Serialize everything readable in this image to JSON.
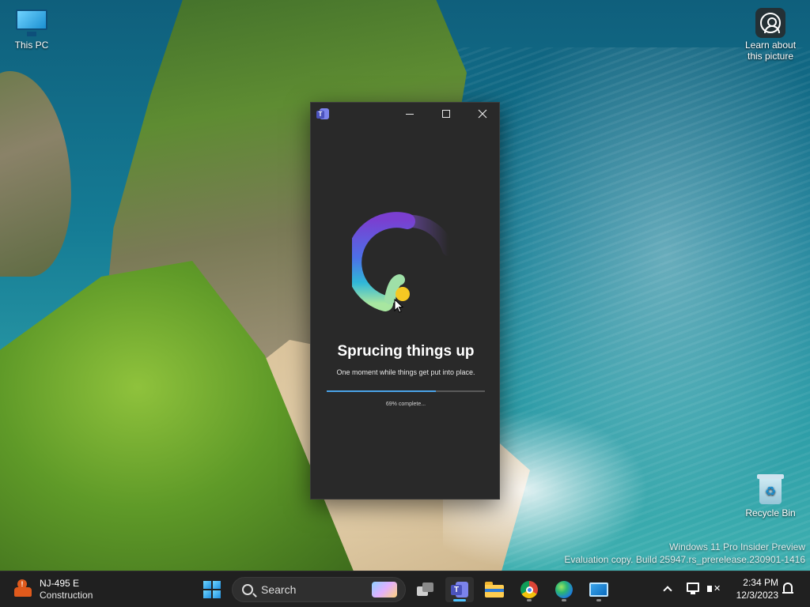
{
  "desktop": {
    "icons": [
      {
        "label": "This PC",
        "icon": "computer-icon"
      },
      {
        "label": "Learn about\nthis picture",
        "icon": "camera-icon"
      },
      {
        "label": "Recycle Bin",
        "icon": "recycle-bin-icon"
      }
    ],
    "watermark": {
      "line1": "Windows 11 Pro Insider Preview",
      "line2": "Evaluation copy. Build 25947.rs_prerelease.230901-1416"
    }
  },
  "teams_window": {
    "app_icon": "teams-icon",
    "title": "Sprucing things up",
    "subtitle": "One moment while things get put into place.",
    "progress": {
      "percent": 69,
      "text": "69% complete..."
    },
    "colors": {
      "background": "#292929",
      "progress_fill": "#4aa3e8",
      "progress_track": "#5a5a5a"
    }
  },
  "taskbar": {
    "weather": {
      "line1": "NJ-495 E",
      "line2": "Construction",
      "icon": "traffic-alert-icon"
    },
    "search": {
      "placeholder": "Search"
    },
    "pinned": [
      {
        "name": "Task View",
        "icon": "task-view-icon"
      },
      {
        "name": "Microsoft Teams",
        "icon": "teams-icon",
        "active": true
      },
      {
        "name": "File Explorer",
        "icon": "folder-icon"
      },
      {
        "name": "Google Chrome",
        "icon": "chrome-icon"
      },
      {
        "name": "Microsoft Edge",
        "icon": "edge-icon"
      },
      {
        "name": "Remote Desktop",
        "icon": "remote-desktop-icon"
      }
    ],
    "clock": {
      "time": "2:34 PM",
      "date": "12/3/2023"
    },
    "accent": "#4cc2ff"
  }
}
